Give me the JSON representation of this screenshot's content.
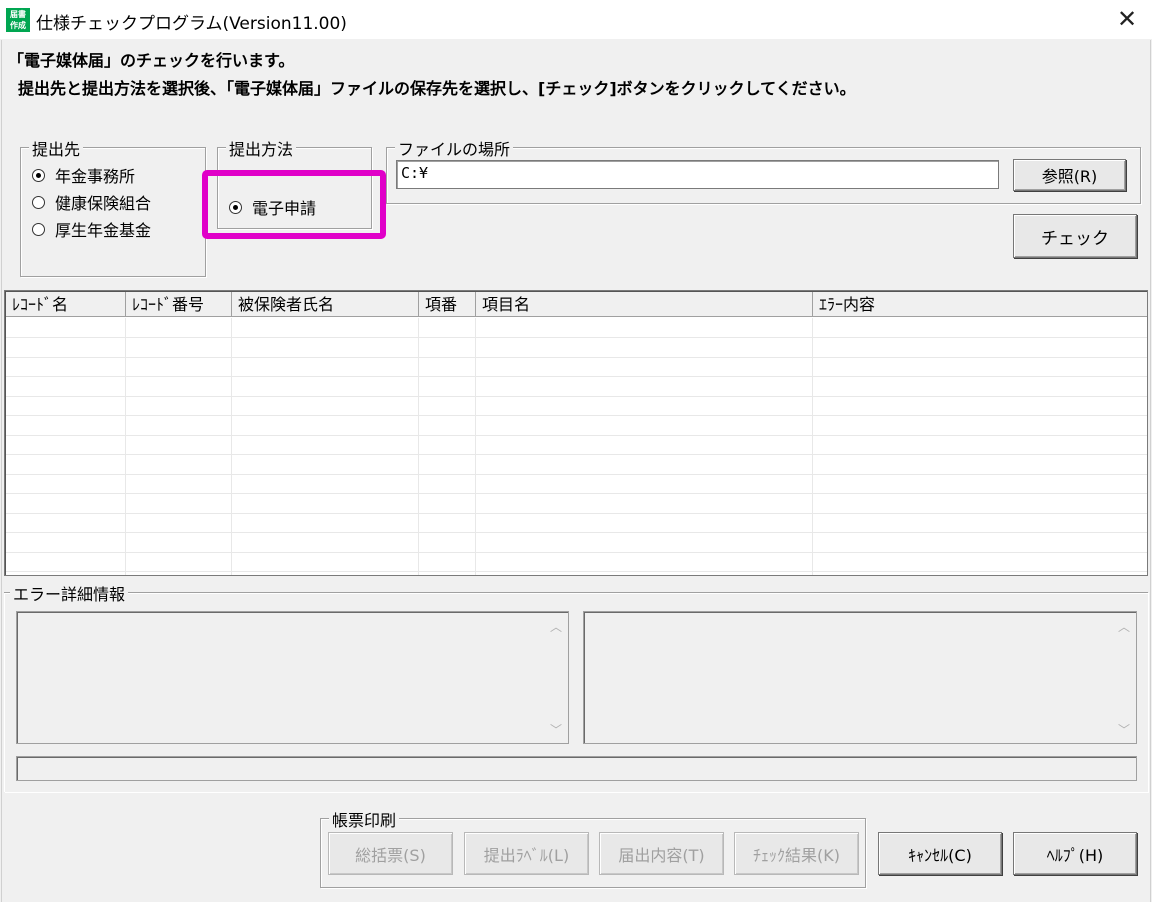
{
  "window": {
    "title": "仕様チェックプログラム(Version11.00)",
    "app_icon_text": "届書\n作成"
  },
  "instructions": {
    "line1": "「電子媒体届」のチェックを行います。",
    "line2": "提出先と提出方法を選択後、「電子媒体届」ファイルの保存先を選択し、[チェック]ボタンをクリックしてください。"
  },
  "destination": {
    "legend": "提出先",
    "options": [
      {
        "label": "年金事務所",
        "checked": true
      },
      {
        "label": "健康保険組合",
        "checked": false
      },
      {
        "label": "厚生年金基金",
        "checked": false
      }
    ]
  },
  "method": {
    "legend": "提出方法",
    "options": [
      {
        "label": "電子申請",
        "checked": true
      }
    ]
  },
  "file_location": {
    "legend": "ファイルの場所",
    "value": "C:¥",
    "browse_label": "参照(R)"
  },
  "check_label": "チェック",
  "grid": {
    "columns": [
      "ﾚｺｰﾄﾞ名",
      "ﾚｺｰﾄﾞ番号",
      "被保険者氏名",
      "項番",
      "項目名",
      "ｴﾗｰ内容"
    ],
    "rows": []
  },
  "error_detail": {
    "legend": "エラー詳細情報"
  },
  "print_group": {
    "legend": "帳票印刷",
    "buttons": [
      "総括票(S)",
      "提出ﾗﾍﾞﾙ(L)",
      "届出内容(T)",
      "ﾁｪｯｸ結果(K)"
    ]
  },
  "cancel_label": "ｷｬﾝｾﾙ(C)",
  "help_label": "ﾍﾙﾌﾟ(H)",
  "colors": {
    "highlight": "#e000c8",
    "app_icon": "#00a651"
  }
}
